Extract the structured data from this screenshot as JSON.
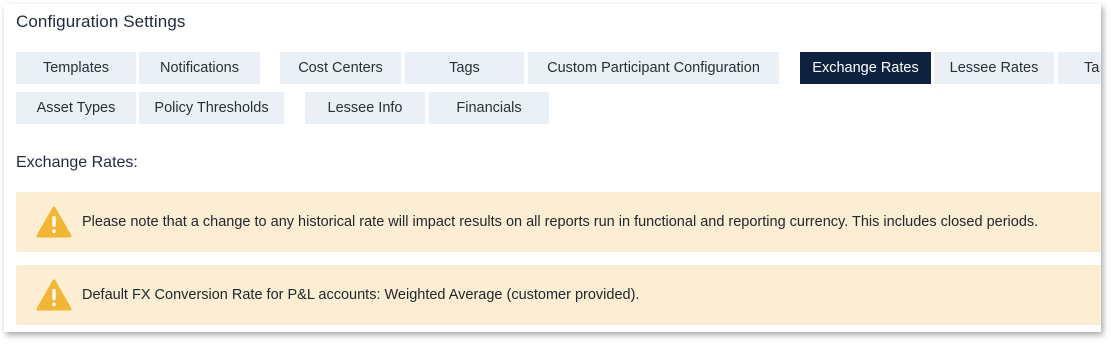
{
  "page": {
    "title": "Configuration Settings",
    "section_title": "Exchange Rates:"
  },
  "tabs_row1": [
    {
      "label": "Templates",
      "active": false
    },
    {
      "label": "Notifications",
      "active": false
    },
    {
      "label": "Cost Centers",
      "active": false
    },
    {
      "label": "Tags",
      "active": false
    },
    {
      "label": "Custom Participant Configuration",
      "active": false
    },
    {
      "label": "Exchange Rates",
      "active": true
    },
    {
      "label": "Lessee Rates",
      "active": false
    },
    {
      "label": "Ta",
      "active": false
    }
  ],
  "tabs_row2": [
    {
      "label": "Asset Types",
      "active": false
    },
    {
      "label": "Policy Thresholds",
      "active": false
    },
    {
      "label": "Lessee Info",
      "active": false
    },
    {
      "label": "Financials",
      "active": false
    }
  ],
  "alerts": [
    {
      "icon": "warning-triangle-icon",
      "text": "Please note that a change to any historical rate will impact results on all reports run in functional and reporting currency. This includes closed periods."
    },
    {
      "icon": "warning-triangle-icon",
      "text": "Default FX Conversion Rate for P&L accounts: Weighted Average (customer provided)."
    }
  ],
  "colors": {
    "active_tab_bg": "#0e2240",
    "tab_bg": "#eaf0f6",
    "alert_bg": "#fbeed2",
    "warning_icon": "#f2b632"
  }
}
